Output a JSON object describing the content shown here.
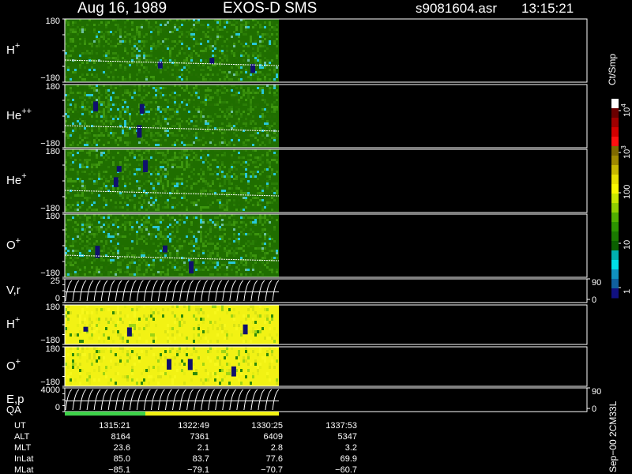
{
  "header": {
    "date": "Aug 16, 1989",
    "instrument": "EXOS-D SMS",
    "file": "s9081604.asr",
    "time": "13:15:21"
  },
  "colors": {
    "background": "#000000",
    "axis": "#ffffff",
    "spectrogram_dark_green": "#1f6e00",
    "spectrogram_green": "#2f8a0a",
    "spectrogram_yellow": "#f2f214",
    "spectrogram_cyan": "#28c8d8",
    "spectrogram_navy": "#10106e",
    "quality_green": "#3fd24a",
    "quality_yellow": "#f2f214"
  },
  "chart_data": {
    "type": "heatmap",
    "time_labels": [
      "1315:21",
      "1322:49",
      "1330:25",
      "1337:53"
    ],
    "panels": [
      {
        "label": "H",
        "sup": "+",
        "y_top": "180",
        "y_bottom": "−180",
        "kind": "spectrogram",
        "base": "green"
      },
      {
        "label": "He",
        "sup": "++",
        "y_top": "180",
        "y_bottom": "−180",
        "kind": "spectrogram",
        "base": "green"
      },
      {
        "label": "He",
        "sup": "+",
        "y_top": "180",
        "y_bottom": "−180",
        "kind": "spectrogram",
        "base": "green"
      },
      {
        "label": "O",
        "sup": "+",
        "y_top": "180",
        "y_bottom": "−180",
        "kind": "spectrogram",
        "base": "green"
      },
      {
        "label": "V,r",
        "sup": "",
        "y_top": "25",
        "y_bottom": "0",
        "right_top": "90",
        "right_bottom": "0",
        "kind": "lines"
      },
      {
        "label": "H",
        "sup": "+",
        "y_top": "180",
        "y_bottom": "−180",
        "kind": "spectrogram",
        "base": "yellow"
      },
      {
        "label": "O",
        "sup": "+",
        "y_top": "180",
        "y_bottom": "−180",
        "kind": "spectrogram",
        "base": "yellow"
      },
      {
        "label": "E,p",
        "sup": "",
        "y_top": "4000",
        "y_bottom": "0",
        "right_top": "90",
        "right_bottom": "0",
        "kind": "lines"
      }
    ],
    "qa_label": "QA",
    "ephemeris": [
      {
        "name": "UT",
        "values": [
          "1315:21",
          "1322:49",
          "1330:25",
          "1337:53"
        ]
      },
      {
        "name": "ALT",
        "values": [
          "8164",
          "7361",
          "6409",
          "5347"
        ]
      },
      {
        "name": "MLT",
        "values": [
          "23.6",
          "2.1",
          "2.8",
          "3.2"
        ]
      },
      {
        "name": "InLat",
        "values": [
          "85.0",
          "83.7",
          "77.6",
          "69.9"
        ]
      },
      {
        "name": "MLat",
        "values": [
          "−85.1",
          "−79.1",
          "−70.7",
          "−60.7"
        ]
      }
    ],
    "colorbar": {
      "unit": "Ct/Smp",
      "tick_labels": [
        "10",
        "10",
        "100",
        "10",
        "1"
      ],
      "exponents": [
        "4",
        "3",
        "",
        "",
        ""
      ],
      "colors": [
        "#ffffff",
        "#6a0000",
        "#a00000",
        "#d40000",
        "#ff1010",
        "#806a00",
        "#a08a00",
        "#c8b800",
        "#e8e000",
        "#f8f800",
        "#c8e800",
        "#90d000",
        "#50b000",
        "#2c9400",
        "#1a7a00",
        "#0a6000",
        "#00b0b0",
        "#00e0e8",
        "#1090c0",
        "#1060a0",
        "#101080"
      ]
    },
    "footer": "Sep−00 2CM33L"
  }
}
